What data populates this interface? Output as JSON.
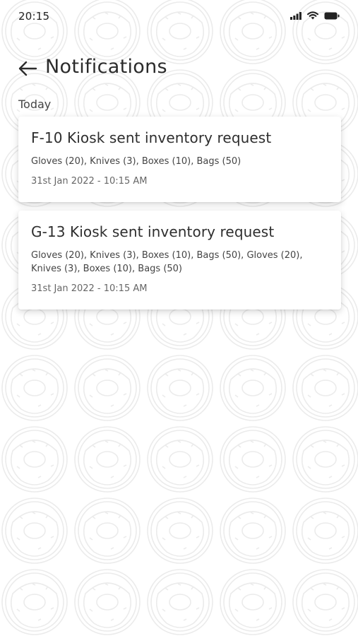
{
  "status_bar": {
    "time": "20:15",
    "icons": [
      "signal-icon",
      "wifi-icon",
      "battery-icon"
    ]
  },
  "header": {
    "back_icon": "arrow-left-icon",
    "title": "Notifications"
  },
  "sections": [
    {
      "label": "Today",
      "notifications": [
        {
          "title": "F-10 Kiosk sent inventory request",
          "items": "Gloves (20), Knives (3), Boxes (10), Bags (50)",
          "date": "31st Jan 2022 - 10:15 AM"
        },
        {
          "title": "G-13 Kiosk sent inventory request",
          "items": "Gloves (20), Knives (3), Boxes (10), Bags (50), Gloves (20), Knives (3), Boxes (10), Bags (50)",
          "date": "31st Jan 2022 - 10:15 AM"
        }
      ]
    }
  ],
  "colors": {
    "background": "#ffffff",
    "pattern_stroke": "#e9e9e9",
    "text_primary": "#2e2e2e",
    "text_secondary": "#666666"
  }
}
